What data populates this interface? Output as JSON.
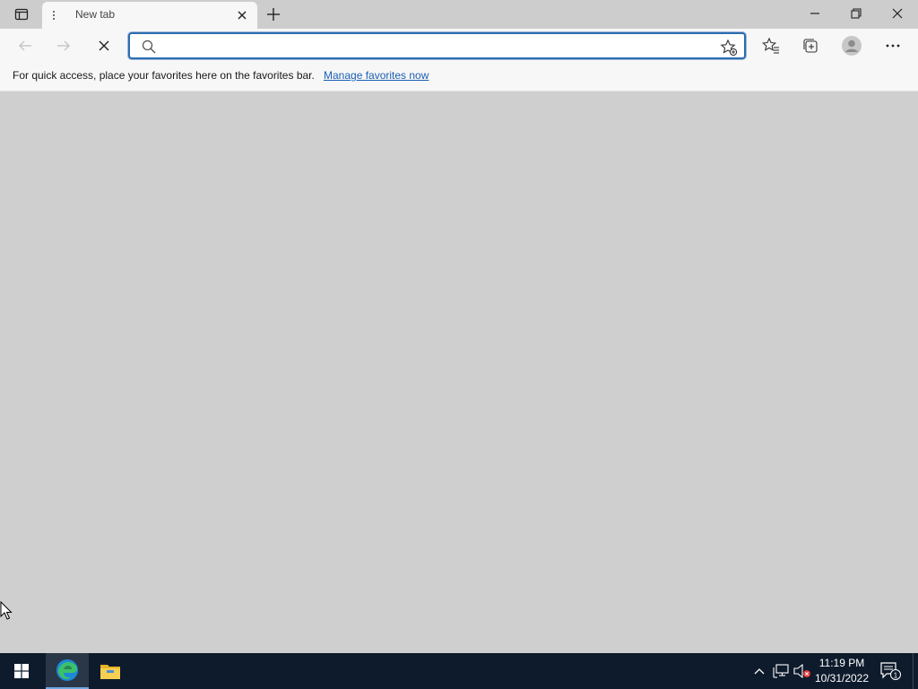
{
  "tab": {
    "title": "New tab"
  },
  "address": {
    "value": "",
    "placeholder": ""
  },
  "favorites_bar": {
    "message": "For quick access, place your favorites here on the favorites bar.",
    "link": "Manage favorites now"
  },
  "taskbar": {
    "time": "11:19 PM",
    "date": "10/31/2022",
    "notification_count": "1",
    "apps": [
      "edge-icon",
      "file-explorer-icon"
    ]
  },
  "colors": {
    "accent": "#2b6cb0",
    "link": "#1a5fb4",
    "taskbar": "#0e1b2c",
    "content": "#cfcfcf"
  }
}
